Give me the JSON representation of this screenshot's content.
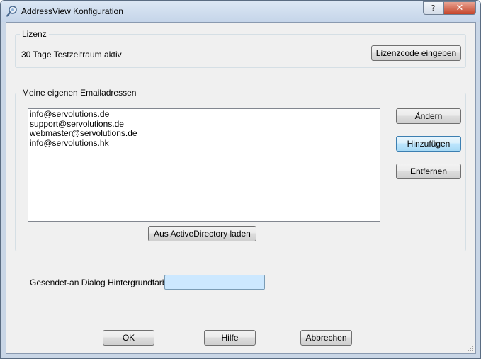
{
  "window": {
    "title": "AddressView Konfiguration",
    "help_label": "?",
    "close_label": "✕"
  },
  "license": {
    "group_label": "Lizenz",
    "status_text": "30 Tage Testzeitraum aktiv",
    "enter_code_label": "Lizenzcode eingeben"
  },
  "emails": {
    "group_label": "Meine eigenen Emailadressen",
    "items": [
      "info@servolutions.de",
      "support@servolutions.de",
      "webmaster@servolutions.de",
      "info@servolutions.hk"
    ],
    "change_label": "Ändern",
    "add_label": "Hinzufügen",
    "remove_label": "Entfernen",
    "load_ad_label": "Aus ActiveDirectory laden"
  },
  "background": {
    "label": "Gesendet-an Dialog Hintergrundfarbe:",
    "color": "#cce8ff"
  },
  "footer": {
    "ok_label": "OK",
    "help_label": "Hilfe",
    "cancel_label": "Abbrechen"
  }
}
